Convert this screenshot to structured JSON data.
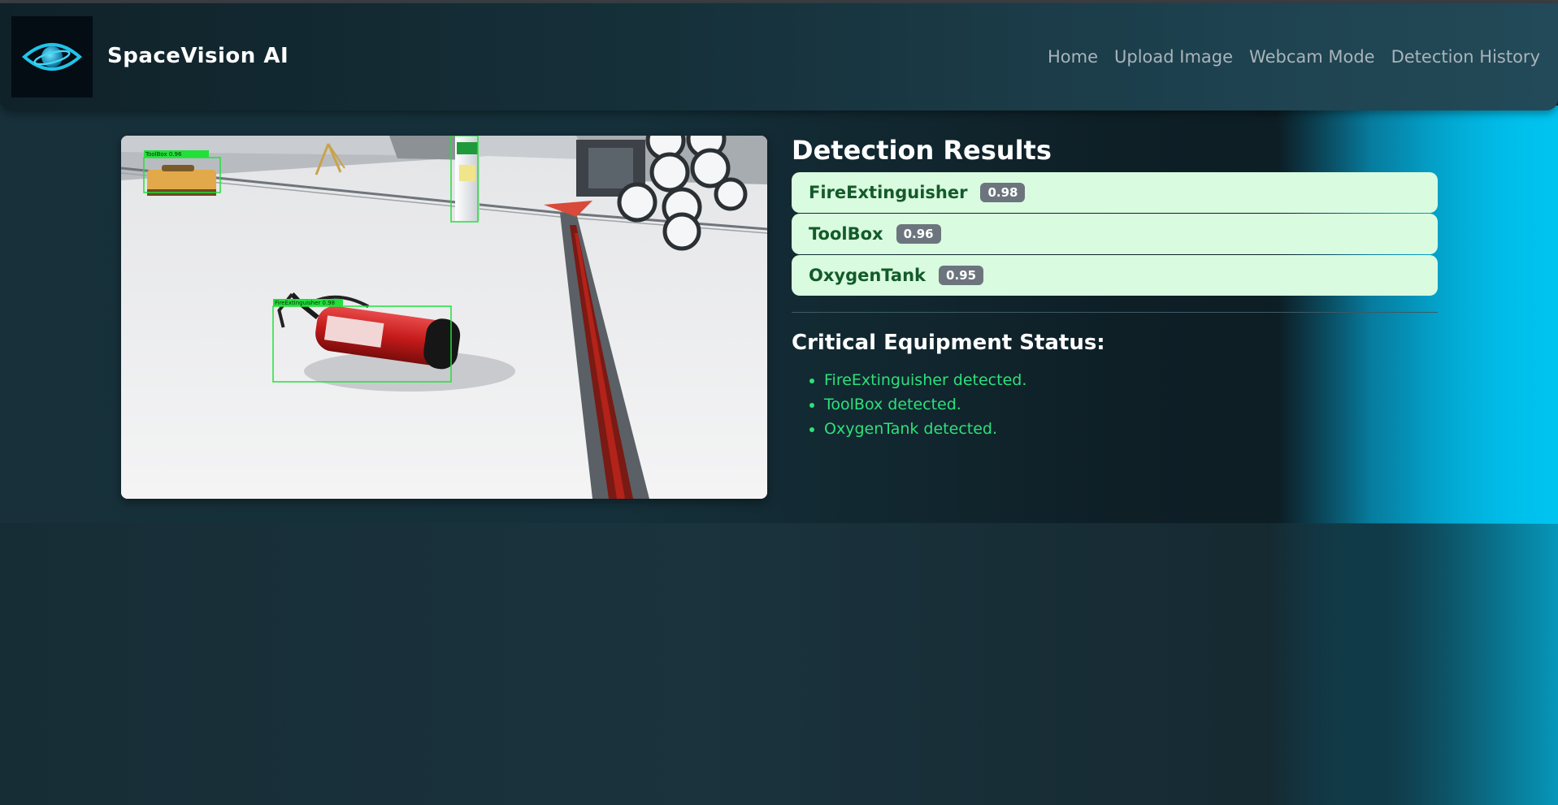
{
  "app": {
    "brand": "SpaceVision AI"
  },
  "nav": {
    "items": [
      "Home",
      "Upload Image",
      "Webcam Mode",
      "Detection History"
    ]
  },
  "image": {
    "boxes": [
      {
        "label": "ToolBox",
        "score": "0.96"
      },
      {
        "label": "FireExtinguisher",
        "score": "0.98"
      },
      {
        "label": "OxygenTank",
        "score": ""
      }
    ]
  },
  "results": {
    "title": "Detection Results",
    "items": [
      {
        "name": "FireExtinguisher",
        "score": "0.98"
      },
      {
        "name": "ToolBox",
        "score": "0.96"
      },
      {
        "name": "OxygenTank",
        "score": "0.95"
      }
    ]
  },
  "status": {
    "title": "Critical Equipment Status:",
    "items": [
      "FireExtinguisher detected.",
      "ToolBox detected.",
      "OxygenTank detected."
    ]
  },
  "colors": {
    "accent_text": "#2ee07a",
    "result_bg": "#d9fbe0",
    "result_text": "#145a2a",
    "badge_bg": "#6c757d",
    "detection_box": "#22e03a"
  },
  "icons": {
    "logo": "planet-eye-icon"
  }
}
